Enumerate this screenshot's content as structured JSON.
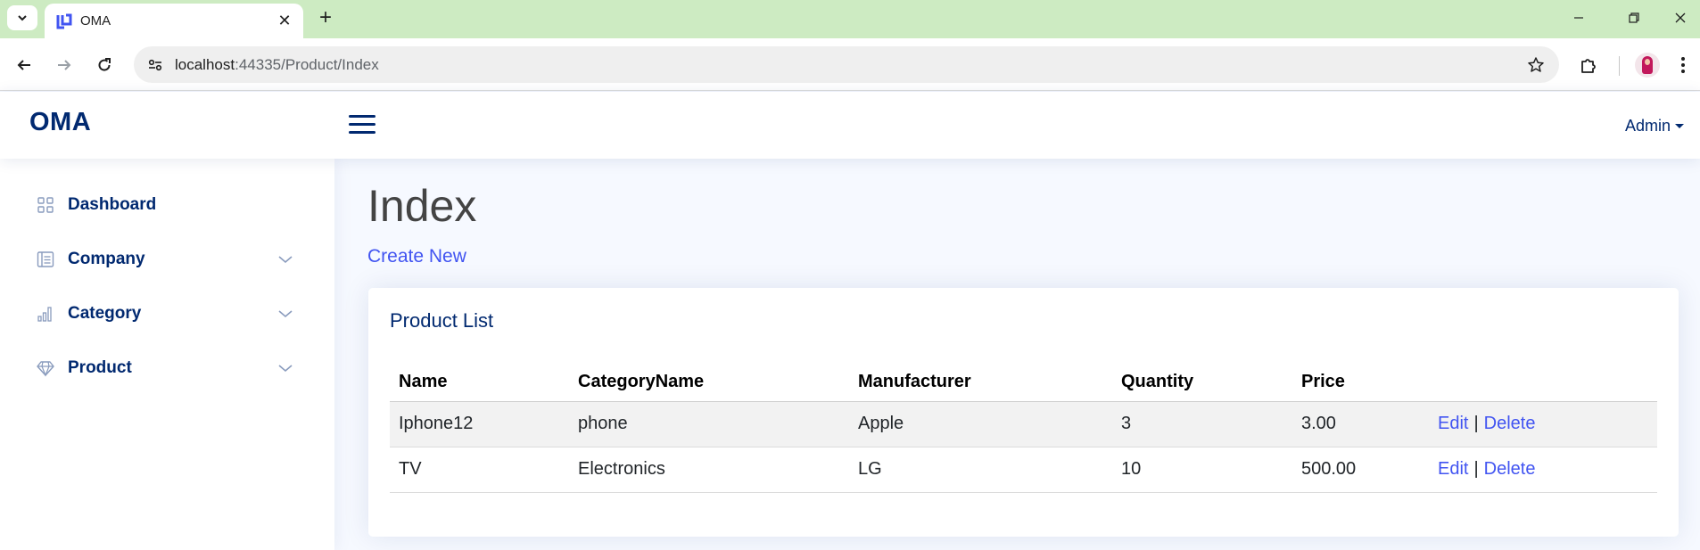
{
  "browser": {
    "tab_title": "OMA",
    "url_host": "localhost",
    "url_rest": ":44335/Product/Index"
  },
  "header": {
    "logo": "OMA",
    "user_menu": "Admin"
  },
  "sidebar": {
    "items": [
      {
        "label": "Dashboard",
        "icon": "grid-icon"
      },
      {
        "label": "Company",
        "icon": "layout-list-icon"
      },
      {
        "label": "Category",
        "icon": "bar-chart-icon"
      },
      {
        "label": "Product",
        "icon": "gem-icon"
      }
    ]
  },
  "main": {
    "title": "Index",
    "create_link": "Create New",
    "card_title": "Product List",
    "columns": [
      "Name",
      "CategoryName",
      "Manufacturer",
      "Quantity",
      "Price"
    ],
    "rows": [
      {
        "name": "Iphone12",
        "category": "phone",
        "manufacturer": "Apple",
        "quantity": "3",
        "price": "3.00",
        "edit": "Edit",
        "sep": "|",
        "delete": "Delete"
      },
      {
        "name": "TV",
        "category": "Electronics",
        "manufacturer": "LG",
        "quantity": "10",
        "price": "500.00",
        "edit": "Edit",
        "sep": "|",
        "delete": "Delete"
      }
    ]
  },
  "colors": {
    "tabbar": "#cdebc2",
    "brand": "#012970",
    "link": "#4154f1",
    "background": "#f6f9ff"
  }
}
